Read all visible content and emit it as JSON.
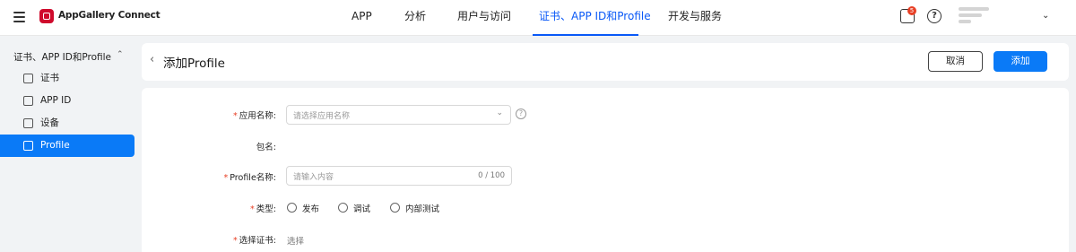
{
  "topbar": {
    "brand": "AppGallery Connect",
    "nav": [
      "APP",
      "分析",
      "用户与访问",
      "证书、APP ID和Profile",
      "开发与服务"
    ],
    "active_nav": "证书、APP ID和Profile",
    "notification_count": "5",
    "help_icon": "?"
  },
  "sidebar": {
    "group": "证书、APP ID和Profile",
    "items": [
      {
        "label": "证书"
      },
      {
        "label": "APP ID"
      },
      {
        "label": "设备"
      },
      {
        "label": "Profile"
      }
    ],
    "active_item": "Profile"
  },
  "header": {
    "title": "添加Profile",
    "cancel_label": "取消",
    "add_label": "添加"
  },
  "form": {
    "app_name_label": "应用名称:",
    "app_name_placeholder": "请选择应用名称",
    "package_label": "包名:",
    "profile_name_label": "Profile名称:",
    "profile_name_placeholder": "请输入内容",
    "profile_name_count": "0 / 100",
    "type_label": "类型:",
    "type_options": [
      "发布",
      "调试",
      "内部测试"
    ],
    "cert_label": "选择证书:",
    "cert_select_text": "选择"
  },
  "colors": {
    "accent": "#0a7af7",
    "active_nav": "#0a59f7",
    "required": "#e84026",
    "brand_logo": "#cf0a2c"
  }
}
